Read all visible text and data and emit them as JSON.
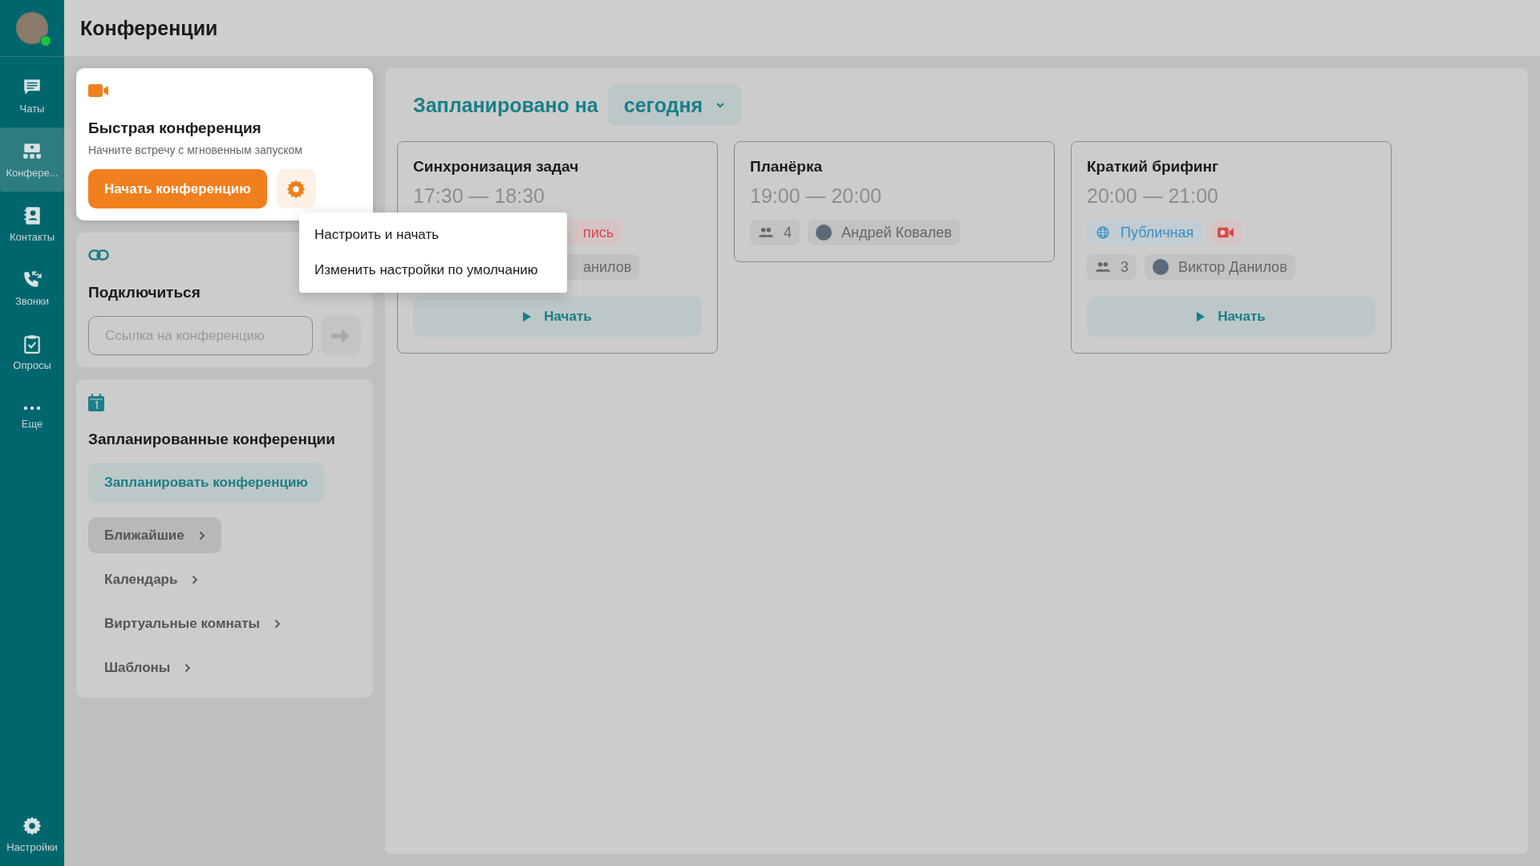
{
  "sidebar": {
    "avatar": {
      "online": true
    },
    "items": [
      {
        "kind": "chats",
        "label": "Чаты",
        "selected": false
      },
      {
        "kind": "conferences",
        "label": "Конфере...",
        "selected": true
      },
      {
        "kind": "contacts",
        "label": "Контакты",
        "selected": false
      },
      {
        "kind": "calls",
        "label": "Звонки",
        "selected": false
      },
      {
        "kind": "polls",
        "label": "Опросы",
        "selected": false
      },
      {
        "kind": "more",
        "label": "Еще",
        "selected": false
      }
    ],
    "settings": {
      "label": "Настройки"
    }
  },
  "header": {
    "title": "Конференции"
  },
  "quick": {
    "title": "Быстрая конференция",
    "subtitle": "Начните встречу с мгновенным запуском",
    "button": "Начать конференцию",
    "menu": [
      "Настроить и начать",
      "Изменить настройки по умолчанию"
    ]
  },
  "join": {
    "title": "Подключиться",
    "placeholder": "Ссылка на конференцию"
  },
  "scheduled": {
    "title": "Запланированные конференции",
    "button": "Запланировать конференцию",
    "links": [
      {
        "label": "Ближайшие",
        "selected": true
      },
      {
        "label": "Календарь",
        "selected": false
      },
      {
        "label": "Виртуальные комнаты",
        "selected": false
      },
      {
        "label": "Шаблоны",
        "selected": false
      }
    ]
  },
  "main": {
    "heading": "Запланировано на",
    "period": "сегодня"
  },
  "meetings": [
    {
      "title": "Синхронизация задач",
      "time": "17:30 — 18:30",
      "tags": [
        {
          "kind": "record",
          "label": "пись"
        }
      ],
      "organizer": "анилов",
      "button": "Начать"
    },
    {
      "title": "Планёрка",
      "time": "19:00 — 20:00",
      "count": "4",
      "organizer": "Андрей Ковалев"
    },
    {
      "title": "Краткий брифинг",
      "time": "20:00 — 21:00",
      "tags": [
        {
          "kind": "public",
          "label": "Публичная"
        },
        {
          "kind": "record"
        }
      ],
      "count": "3",
      "organizer": "Виктор Данилов",
      "button": "Начать"
    }
  ]
}
